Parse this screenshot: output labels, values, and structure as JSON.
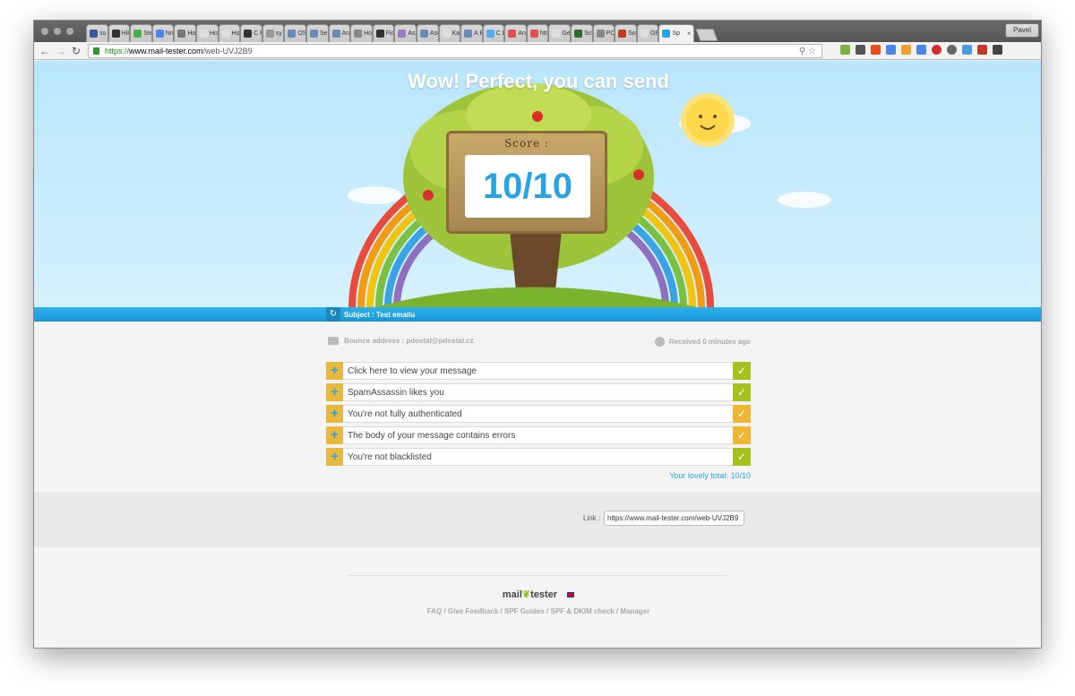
{
  "browser": {
    "tabs": [
      "so",
      "Hik",
      "Ste",
      "Nm",
      "Ho",
      "Ho",
      "Ho",
      "C F",
      "sy",
      "OS",
      "Se",
      "Ara",
      "Ho",
      "Fic",
      "Asi",
      "Asi",
      "Ka",
      "A E",
      "C F",
      "Ani",
      "htt",
      "Ge",
      "Sci",
      "PC",
      "So",
      "GE"
    ],
    "active_tab": "Sp",
    "active_tab_close": "×",
    "profile": "Pavel",
    "url_scheme": "https://",
    "url_host": "www.mail-tester.com",
    "url_path": "/web-UVJ2B9",
    "tab_colors": [
      "#3b5998",
      "#333333",
      "#4caf50",
      "#4a86e8",
      "#777777",
      "#dddddd",
      "#dddddd",
      "#333333",
      "#999999",
      "#6a8ab8",
      "#6a8ab8",
      "#6a8ab8",
      "#888888",
      "#333333",
      "#9a7fc0",
      "#6a8ab8",
      "#dddddd",
      "#6a8ab8",
      "#55acee",
      "#e05050",
      "#e05050",
      "#dddddd",
      "#2a6a2a",
      "#888888",
      "#c0392b",
      "#dddddd"
    ]
  },
  "hero": {
    "title": "Wow! Perfect, you can send",
    "score_label": "Score :",
    "score_value": "10/10"
  },
  "subject": {
    "text": "Subject : Test emailu"
  },
  "meta": {
    "bounce": "Bounce address : pdostal@pdostal.cz",
    "received": "Received 0 minutes ago"
  },
  "checks": [
    {
      "label": "Click here to view your message",
      "status_color": "#a6c11f"
    },
    {
      "label": "SpamAssassin likes you",
      "status_color": "#a6c11f"
    },
    {
      "label": "You're not fully authenticated",
      "status_color": "#efb737"
    },
    {
      "label": "The body of your message contains errors",
      "status_color": "#efb737"
    },
    {
      "label": "You're not blacklisted",
      "status_color": "#a6c11f"
    }
  ],
  "total": {
    "label": "Your lovely total:",
    "value": "10/10"
  },
  "link": {
    "label": "Link :",
    "value": "https://www.mail-tester.com/web-UVJ2B9"
  },
  "footer": {
    "logo_left": "mail",
    "logo_right": "tester",
    "links": "FAQ / Give Feedback / SPF Guides / SPF & DKIM check / Manager"
  },
  "colors": {
    "accent_blue": "#2aa4e0",
    "ok_green": "#a6c11f",
    "warn_orange": "#efb737"
  }
}
